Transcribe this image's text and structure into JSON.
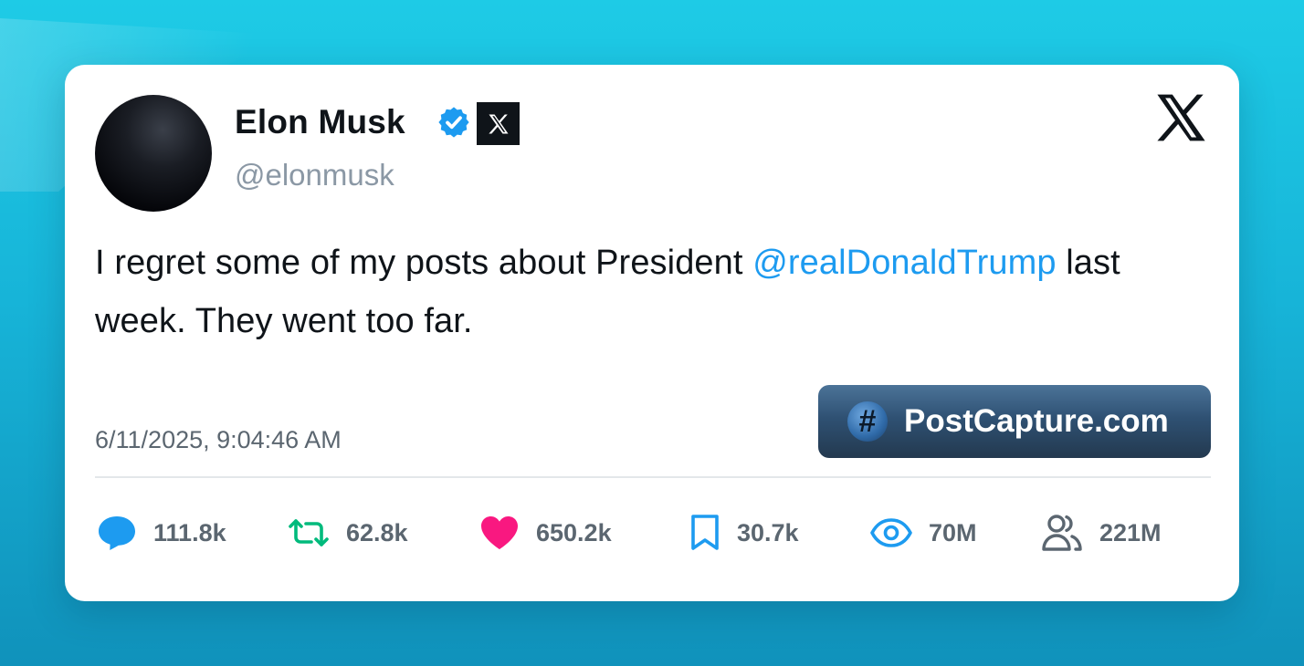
{
  "author": {
    "name": "Elon Musk",
    "handle": "@elonmusk"
  },
  "tweet": {
    "text_before": "I regret some of my posts about President ",
    "mention": "@realDonaldTrump",
    "text_after": " last week. They went too far.",
    "timestamp": "6/11/2025, 9:04:46 AM"
  },
  "watermark": {
    "icon_glyph": "#",
    "label": "PostCapture.com"
  },
  "stats": {
    "replies": "111.8k",
    "reposts": "62.8k",
    "likes": "650.2k",
    "bookmarks": "30.7k",
    "views": "70M",
    "followers": "221M"
  },
  "icons": [
    "verified-icon",
    "x-badge-icon",
    "x-logo-icon",
    "reply-icon",
    "repost-icon",
    "like-icon",
    "bookmark-icon",
    "views-icon",
    "followers-icon"
  ],
  "colors": {
    "accent": "#1d9bf0",
    "repost": "#00ba7c",
    "like": "#f91880",
    "text": "#0f1419",
    "muted": "#5b6670"
  }
}
